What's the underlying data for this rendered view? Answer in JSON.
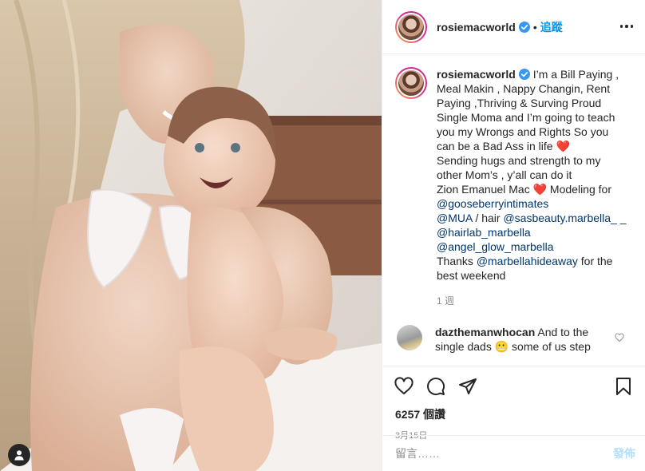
{
  "header": {
    "username": "rosiemacworld",
    "separator": "•",
    "follow_label": "追蹤"
  },
  "caption": {
    "username": "rosiemacworld",
    "text_1": "I’m a Bill Paying , Meal Makin , Nappy Changin, Rent Paying ,Thriving & Surving Proud Single Moma and I’m going to teach you my Wrongs and Rights So you can be a Bad Ass in life ",
    "heart_1": "❤️",
    "text_2": "Sending hugs and strength to my other Mom’s , y’all can do it",
    "text_3": "Zion Emanuel Mac ",
    "heart_2": "❤️",
    "text_3b": " Modeling for",
    "mention_1": "@gooseberryintimates",
    "mention_2": "@MUA",
    "text_4": " / hair ",
    "mention_3": "@sasbeauty.marbella_",
    "text_5": " _",
    "mention_4": "@hairlab_marbella",
    "mention_5": "@angel_glow_marbella",
    "text_6": "Thanks ",
    "mention_6": "@marbellahideaway",
    "text_7": " for the best weekend",
    "time_ago": "1 週"
  },
  "comment": {
    "username": "dazthemanwhocan",
    "text": " And to the single dads ",
    "emoji": "😬",
    "text_tail": " some of us step"
  },
  "stats": {
    "views": "6257 個讚",
    "date": "3月15日"
  },
  "compose": {
    "placeholder": "留言……",
    "post_label": "發佈"
  },
  "icons": {
    "verified": "verified-badge-icon",
    "more": "more-options-icon",
    "like": "heart-outline-icon",
    "comment": "comment-bubble-icon",
    "share": "paper-plane-icon",
    "save": "bookmark-icon",
    "user_tag": "person-icon"
  },
  "colors": {
    "follow_blue": "#0095f6",
    "mention": "#00376b",
    "verified": "#3897f0",
    "post_disabled": "#b2dffc"
  }
}
